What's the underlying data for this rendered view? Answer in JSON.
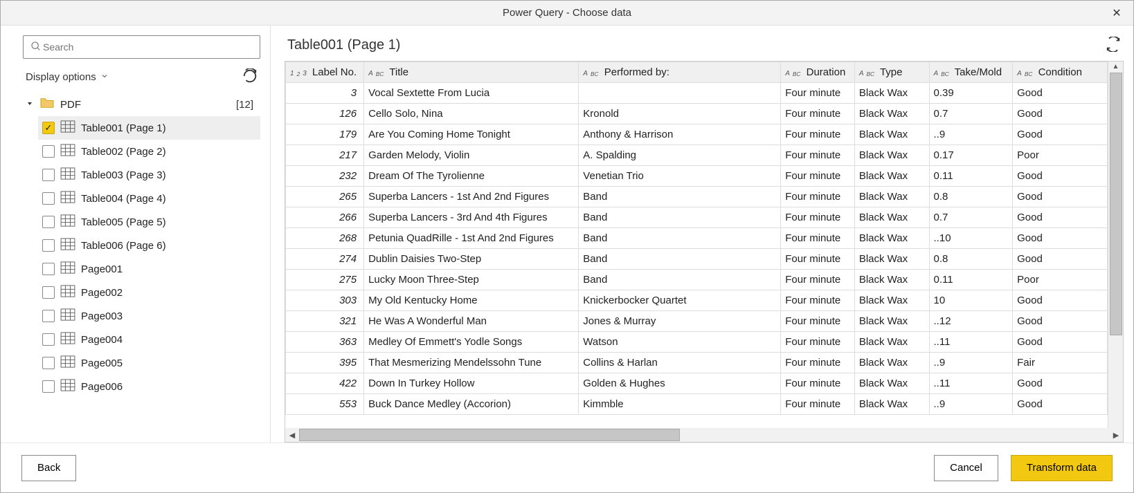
{
  "window": {
    "title": "Power Query - Choose data"
  },
  "left": {
    "search_placeholder": "Search",
    "display_options": "Display options",
    "folder_name": "PDF",
    "folder_count": "[12]",
    "items": [
      {
        "label": "Table001 (Page 1)",
        "kind": "table",
        "checked": true,
        "selected": true
      },
      {
        "label": "Table002 (Page 2)",
        "kind": "table",
        "checked": false,
        "selected": false
      },
      {
        "label": "Table003 (Page 3)",
        "kind": "table",
        "checked": false,
        "selected": false
      },
      {
        "label": "Table004 (Page 4)",
        "kind": "table",
        "checked": false,
        "selected": false
      },
      {
        "label": "Table005 (Page 5)",
        "kind": "table",
        "checked": false,
        "selected": false
      },
      {
        "label": "Table006 (Page 6)",
        "kind": "table",
        "checked": false,
        "selected": false
      },
      {
        "label": "Page001",
        "kind": "page",
        "checked": false,
        "selected": false
      },
      {
        "label": "Page002",
        "kind": "page",
        "checked": false,
        "selected": false
      },
      {
        "label": "Page003",
        "kind": "page",
        "checked": false,
        "selected": false
      },
      {
        "label": "Page004",
        "kind": "page",
        "checked": false,
        "selected": false
      },
      {
        "label": "Page005",
        "kind": "page",
        "checked": false,
        "selected": false
      },
      {
        "label": "Page006",
        "kind": "page",
        "checked": false,
        "selected": false
      }
    ]
  },
  "preview": {
    "title": "Table001 (Page 1)",
    "columns": [
      {
        "name": "Label No.",
        "type": "num"
      },
      {
        "name": "Title",
        "type": "text"
      },
      {
        "name": "Performed by:",
        "type": "text"
      },
      {
        "name": "Duration",
        "type": "text"
      },
      {
        "name": "Type",
        "type": "text"
      },
      {
        "name": "Take/Mold",
        "type": "text"
      },
      {
        "name": "Condition",
        "type": "text"
      }
    ],
    "rows": [
      [
        "3",
        "Vocal Sextette From Lucia",
        "",
        "Four minute",
        "Black Wax",
        "0.39",
        "Good"
      ],
      [
        "126",
        "Cello Solo, Nina",
        "Kronold",
        "Four minute",
        "Black Wax",
        "0.7",
        "Good"
      ],
      [
        "179",
        "Are You Coming Home Tonight",
        "Anthony & Harrison",
        "Four minute",
        "Black Wax",
        "..9",
        "Good"
      ],
      [
        "217",
        "Garden Melody, Violin",
        "A. Spalding",
        "Four minute",
        "Black Wax",
        "0.17",
        "Poor"
      ],
      [
        "232",
        "Dream Of The Tyrolienne",
        "Venetian Trio",
        "Four minute",
        "Black Wax",
        "0.11",
        "Good"
      ],
      [
        "265",
        "Superba Lancers - 1st And 2nd Figures",
        "Band",
        "Four minute",
        "Black Wax",
        "0.8",
        "Good"
      ],
      [
        "266",
        "Superba Lancers - 3rd And 4th Figures",
        "Band",
        "Four minute",
        "Black Wax",
        "0.7",
        "Good"
      ],
      [
        "268",
        "Petunia QuadRille - 1st And 2nd Figures",
        "Band",
        "Four minute",
        "Black Wax",
        "..10",
        "Good"
      ],
      [
        "274",
        "Dublin Daisies Two-Step",
        "Band",
        "Four minute",
        "Black Wax",
        "0.8",
        "Good"
      ],
      [
        "275",
        "Lucky Moon Three-Step",
        "Band",
        "Four minute",
        "Black Wax",
        "0.11",
        "Poor"
      ],
      [
        "303",
        "My Old Kentucky Home",
        "Knickerbocker Quartet",
        "Four minute",
        "Black Wax",
        "10",
        "Good"
      ],
      [
        "321",
        "He Was A Wonderful Man",
        "Jones & Murray",
        "Four minute",
        "Black Wax",
        "..12",
        "Good"
      ],
      [
        "363",
        "Medley Of Emmett's Yodle Songs",
        "Watson",
        "Four minute",
        "Black Wax",
        "..11",
        "Good"
      ],
      [
        "395",
        "That Mesmerizing Mendelssohn Tune",
        "Collins & Harlan",
        "Four minute",
        "Black Wax",
        "..9",
        "Fair"
      ],
      [
        "422",
        "Down In Turkey Hollow",
        "Golden & Hughes",
        "Four minute",
        "Black Wax",
        "..11",
        "Good"
      ],
      [
        "553",
        "Buck Dance Medley (Accorion)",
        "Kimmble",
        "Four minute",
        "Black Wax",
        "..9",
        "Good"
      ]
    ]
  },
  "footer": {
    "back": "Back",
    "cancel": "Cancel",
    "transform": "Transform data"
  }
}
